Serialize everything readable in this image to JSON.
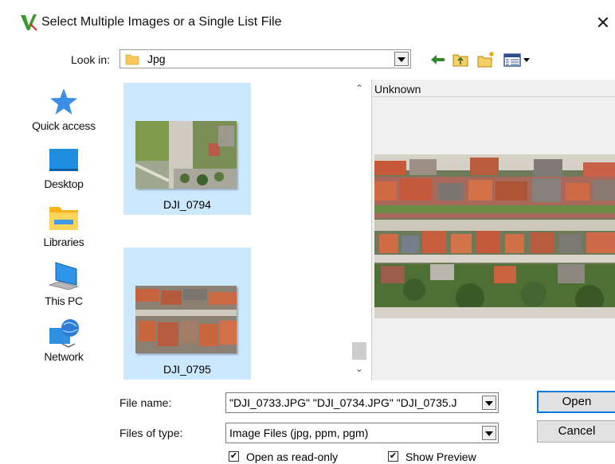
{
  "window": {
    "title": "Select Multiple Images or a Single List File",
    "close_glyph": "✕",
    "app_icon": "app-logo-icon"
  },
  "lookin": {
    "label": "Look in:",
    "value": "Jpg",
    "icons": [
      "folder-icon",
      "back-arrow-icon",
      "up-folder-icon",
      "new-folder-icon",
      "view-menu-icon"
    ]
  },
  "places": [
    {
      "label": "Quick access",
      "icon": "star-icon"
    },
    {
      "label": "Desktop",
      "icon": "desktop-icon"
    },
    {
      "label": "Libraries",
      "icon": "libraries-icon"
    },
    {
      "label": "This PC",
      "icon": "computer-icon"
    },
    {
      "label": "Network",
      "icon": "network-icon"
    }
  ],
  "files": [
    {
      "name": "DJI_0794",
      "selected": true
    },
    {
      "name": "DJI_0795",
      "selected": true
    }
  ],
  "scrollbar": {
    "up": "⌃",
    "down": "⌄"
  },
  "preview": {
    "header": "Unknown"
  },
  "form": {
    "filename_label": "File name:",
    "filename_value": "\"DJI_0733.JPG\" \"DJI_0734.JPG\" \"DJI_0735.J",
    "filetype_label": "Files of type:",
    "filetype_value": "Image Files (jpg, ppm, pgm)",
    "open_label": "Open",
    "cancel_label": "Cancel",
    "readonly_label": "Open as read-only",
    "readonly_checked": true,
    "showpreview_label": "Show Preview",
    "showpreview_checked": true,
    "check_glyph": "✔"
  },
  "colors": {
    "selection": "#cce8ff",
    "accent": "#0078d7"
  }
}
